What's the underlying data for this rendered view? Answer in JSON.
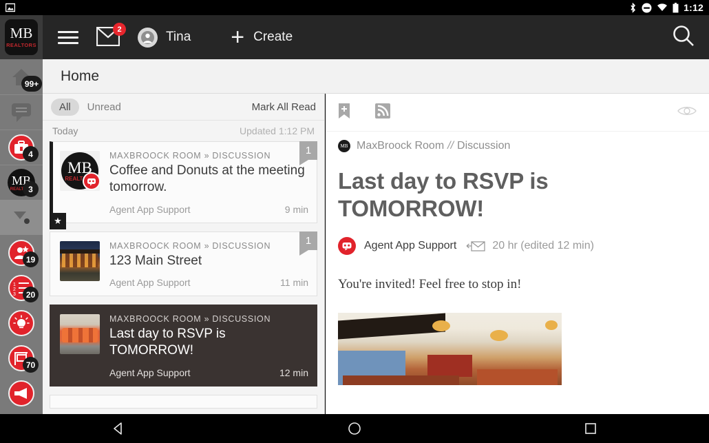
{
  "status_bar": {
    "time": "1:12",
    "icons": [
      "screenshot-icon",
      "bluetooth-icon",
      "dnd-icon",
      "wifi-icon",
      "battery-icon"
    ]
  },
  "app_bar": {
    "logo_main": "MB",
    "logo_sub": "REALTORS",
    "menu_icon": "hamburger-icon",
    "mail_icon": "envelope-icon",
    "mail_badge": "2",
    "avatar_icon": "person-icon",
    "username": "Tina",
    "create_plus": "+",
    "create_label": "Create",
    "search_icon": "search-icon"
  },
  "page": {
    "title": "Home"
  },
  "rail": {
    "items": [
      {
        "name": "home-icon",
        "badge": "99+",
        "style": "gray"
      },
      {
        "name": "chat-bubble-icon",
        "badge": "",
        "style": "gray"
      },
      {
        "name": "briefcase-icon",
        "badge": "4",
        "style": "red"
      },
      {
        "name": "mb-realtors-icon",
        "badge": "3",
        "style": "black"
      },
      {
        "name": "dropdown-caret-icon",
        "badge": "",
        "style": "selected"
      },
      {
        "name": "add-contact-icon",
        "badge": "19",
        "style": "red"
      },
      {
        "name": "checklist-icon",
        "badge": "20",
        "style": "red"
      },
      {
        "name": "lightbulb-icon",
        "badge": "",
        "style": "red"
      },
      {
        "name": "yard-sign-icon",
        "badge": "70",
        "style": "red"
      },
      {
        "name": "megaphone-icon",
        "badge": "",
        "style": "red"
      }
    ]
  },
  "list": {
    "filters": [
      {
        "label": "All",
        "active": true
      },
      {
        "label": "Unread",
        "active": false
      }
    ],
    "mark_all_read": "Mark All Read",
    "date_label": "Today",
    "updated_label": "Updated 1:12 PM",
    "cards": [
      {
        "kicker": "MAXBROOCK ROOM » DISCUSSION",
        "title": "Coffee and Donuts at the meeting tomorrow.",
        "author": "Agent App Support",
        "time": "9 min",
        "count": "1",
        "starred": true,
        "unread": true,
        "active": false,
        "thumb": "mb-logo-thumb"
      },
      {
        "kicker": "MAXBROOCK ROOM » DISCUSSION",
        "title": "123 Main Street",
        "author": "Agent App Support",
        "time": "11 min",
        "count": "1",
        "starred": false,
        "unread": false,
        "active": false,
        "thumb": "house-photo-thumb"
      },
      {
        "kicker": "MAXBROOCK ROOM » DISCUSSION",
        "title": "Last day to RSVP is TOMORROW!",
        "author": "Agent App Support",
        "time": "12 min",
        "count": "",
        "starred": false,
        "unread": false,
        "active": true,
        "thumb": "room-photo-thumb"
      }
    ]
  },
  "detail": {
    "toolbar": {
      "bookmark_icon": "bookmark-add-icon",
      "rss_icon": "rss-feed-icon",
      "views_icon": "eye-icon"
    },
    "breadcrumb_room": "MaxBroock Room",
    "breadcrumb_sep": "//",
    "breadcrumb_section": "Discussion",
    "title": "Last day to RSVP is TOMORROW!",
    "author": "Agent App Support",
    "author_icon": "agent-support-avatar",
    "envelope_icon": "reply-envelope-icon",
    "timestamp": "20 hr (edited 12 min)",
    "body": "You're invited! Feel free to stop in!",
    "photo": "restaurant-interior-photo"
  },
  "nav_bar": {
    "back": "back-triangle-icon",
    "home": "home-circle-icon",
    "recents": "recents-square-icon"
  },
  "colors": {
    "accent_red": "#e1232b",
    "app_bar": "#262626",
    "rail": "#7a7a7a",
    "active_card": "#3a3331"
  }
}
